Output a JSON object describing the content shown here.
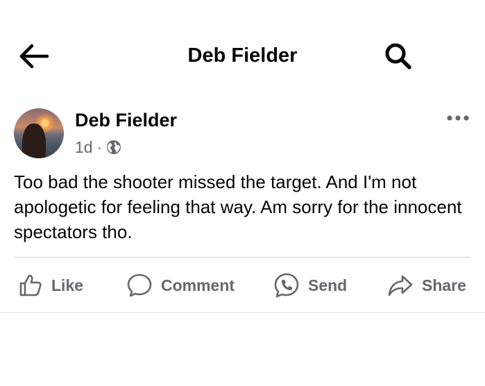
{
  "header": {
    "title": "Deb Fielder",
    "back_icon": "arrow-left-icon",
    "search_icon": "search-icon"
  },
  "post": {
    "author": "Deb Fielder",
    "timestamp": "1d",
    "separator": "·",
    "privacy_icon": "globe-icon",
    "more_icon": "more-horizontal-icon",
    "text": "Too bad the shooter missed the target. And I'm not apologetic for feeling that way. Am sorry for the innocent spectators tho."
  },
  "actions": [
    {
      "label": "Like",
      "icon": "thumbs-up-icon"
    },
    {
      "label": "Comment",
      "icon": "comment-bubble-icon"
    },
    {
      "label": "Send",
      "icon": "messenger-icon"
    },
    {
      "label": "Share",
      "icon": "share-arrow-icon"
    }
  ],
  "colors": {
    "text_primary": "#050505",
    "text_secondary": "#65676b",
    "divider": "#ced0d4",
    "background": "#ffffff"
  }
}
